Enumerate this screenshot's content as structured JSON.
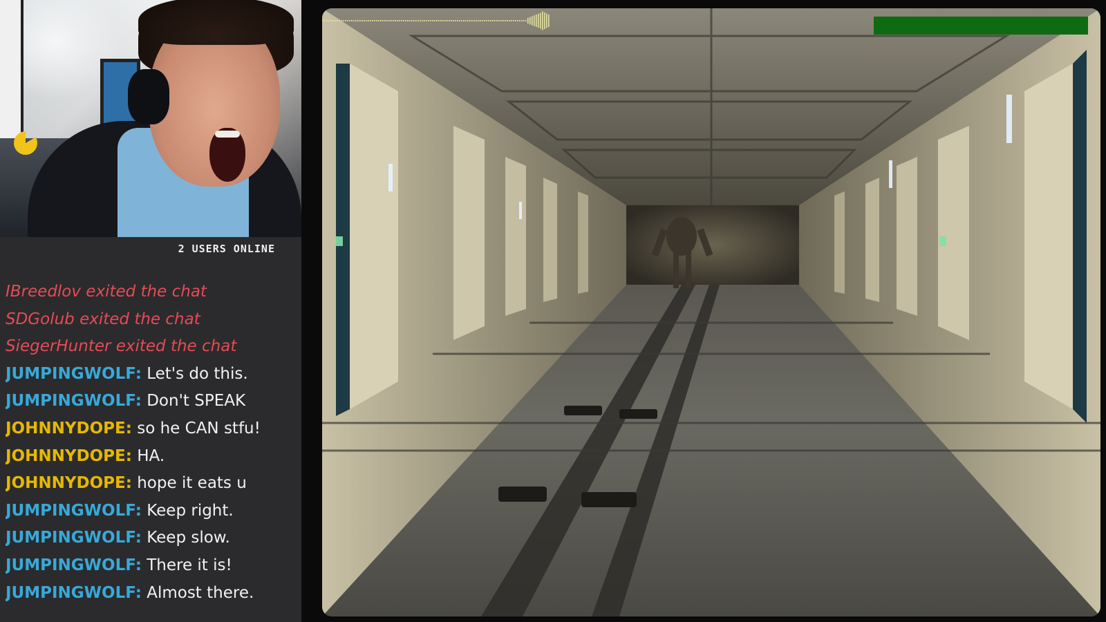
{
  "chat": {
    "users_online": "2 USERS ONLINE",
    "messages": [
      {
        "type": "system",
        "text": "IBreedlov exited the chat"
      },
      {
        "type": "system",
        "text": "SDGolub exited the chat"
      },
      {
        "type": "system",
        "text": "SiegerHunter exited the chat"
      },
      {
        "type": "message",
        "user": "JUMPINGWOLF:",
        "color": "#38a9d9",
        "text": " Let's do this."
      },
      {
        "type": "message",
        "user": "JUMPINGWOLF:",
        "color": "#38a9d9",
        "text": " Don't SPEAK"
      },
      {
        "type": "message",
        "user": "JOHNNYDOPE:",
        "color": "#e6b800",
        "text": " so he CAN stfu!"
      },
      {
        "type": "message",
        "user": "JOHNNYDOPE:",
        "color": "#e6b800",
        "text": " HA."
      },
      {
        "type": "message",
        "user": "JOHNNYDOPE:",
        "color": "#e6b800",
        "text": " hope it eats u"
      },
      {
        "type": "message",
        "user": "JUMPINGWOLF:",
        "color": "#38a9d9",
        "text": " Keep right."
      },
      {
        "type": "message",
        "user": "JUMPINGWOLF:",
        "color": "#38a9d9",
        "text": " Keep slow."
      },
      {
        "type": "message",
        "user": "JUMPINGWOLF:",
        "color": "#38a9d9",
        "text": " There it is!"
      },
      {
        "type": "message",
        "user": "JUMPINGWOLF:",
        "color": "#38a9d9",
        "text": " Almost there."
      }
    ]
  },
  "game": {
    "health_fraction": 1.0,
    "health_color": "#0e6b12"
  },
  "colors": {
    "system_message": "#e64b56",
    "user_wolf": "#38a9d9",
    "user_dope": "#e6b800",
    "chat_background": "#2b2b2d"
  }
}
